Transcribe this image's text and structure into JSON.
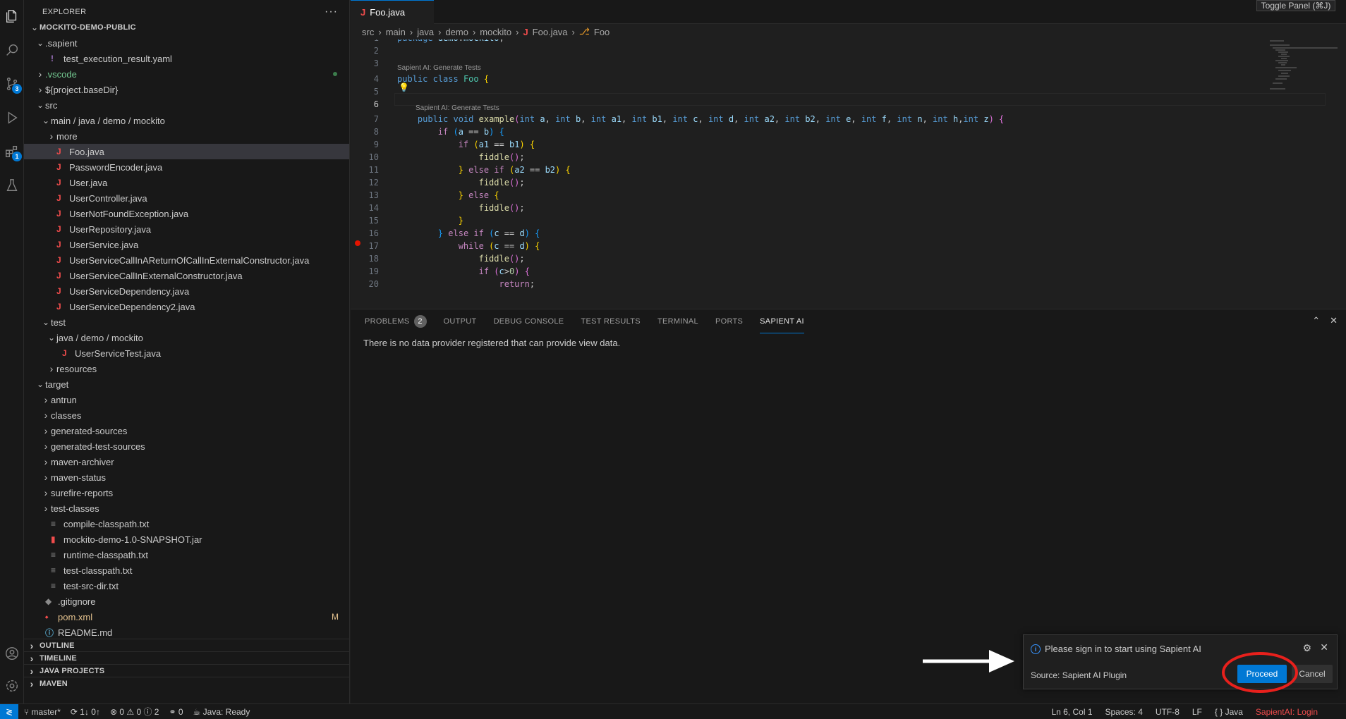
{
  "explorer": {
    "title": "EXPLORER",
    "more": "···",
    "items": [
      {
        "label": "MOCKITO-DEMO-PUBLIC",
        "twisty": "down",
        "indent": 0,
        "bold": true
      },
      {
        "label": ".sapient",
        "twisty": "down",
        "indent": 1
      },
      {
        "label": "test_execution_result.yaml",
        "icon": "!",
        "indent": 2
      },
      {
        "label": ".vscode",
        "twisty": "right",
        "indent": 1,
        "color": "#73c991",
        "dot": true
      },
      {
        "label": "${project.baseDir}",
        "twisty": "right",
        "indent": 1
      },
      {
        "label": "src",
        "twisty": "down",
        "indent": 1
      },
      {
        "label": "main / java / demo / mockito",
        "twisty": "down",
        "indent": 2
      },
      {
        "label": "more",
        "twisty": "right",
        "indent": 3
      },
      {
        "label": "Foo.java",
        "icon": "J",
        "indent": 3,
        "selected": true
      },
      {
        "label": "PasswordEncoder.java",
        "icon": "J",
        "indent": 3
      },
      {
        "label": "User.java",
        "icon": "J",
        "indent": 3
      },
      {
        "label": "UserController.java",
        "icon": "J",
        "indent": 3
      },
      {
        "label": "UserNotFoundException.java",
        "icon": "J",
        "indent": 3
      },
      {
        "label": "UserRepository.java",
        "icon": "J",
        "indent": 3
      },
      {
        "label": "UserService.java",
        "icon": "J",
        "indent": 3
      },
      {
        "label": "UserServiceCallInAReturnOfCallInExternalConstructor.java",
        "icon": "J",
        "indent": 3
      },
      {
        "label": "UserServiceCallInExternalConstructor.java",
        "icon": "J",
        "indent": 3
      },
      {
        "label": "UserServiceDependency.java",
        "icon": "J",
        "indent": 3
      },
      {
        "label": "UserServiceDependency2.java",
        "icon": "J",
        "indent": 3
      },
      {
        "label": "test",
        "twisty": "down",
        "indent": 2
      },
      {
        "label": "java / demo / mockito",
        "twisty": "down",
        "indent": 3
      },
      {
        "label": "UserServiceTest.java",
        "icon": "J",
        "indent": 4
      },
      {
        "label": "resources",
        "twisty": "right",
        "indent": 3
      },
      {
        "label": "target",
        "twisty": "down",
        "indent": 1
      },
      {
        "label": "antrun",
        "twisty": "right",
        "indent": 2
      },
      {
        "label": "classes",
        "twisty": "right",
        "indent": 2
      },
      {
        "label": "generated-sources",
        "twisty": "right",
        "indent": 2
      },
      {
        "label": "generated-test-sources",
        "twisty": "right",
        "indent": 2
      },
      {
        "label": "maven-archiver",
        "twisty": "right",
        "indent": 2
      },
      {
        "label": "maven-status",
        "twisty": "right",
        "indent": 2
      },
      {
        "label": "surefire-reports",
        "twisty": "right",
        "indent": 2
      },
      {
        "label": "test-classes",
        "twisty": "right",
        "indent": 2
      },
      {
        "label": "compile-classpath.txt",
        "icon": "≡",
        "indent": 2
      },
      {
        "label": "mockito-demo-1.0-SNAPSHOT.jar",
        "icon": "▮",
        "indent": 2
      },
      {
        "label": "runtime-classpath.txt",
        "icon": "≡",
        "indent": 2
      },
      {
        "label": "test-classpath.txt",
        "icon": "≡",
        "indent": 2
      },
      {
        "label": "test-src-dir.txt",
        "icon": "≡",
        "indent": 2
      },
      {
        "label": ".gitignore",
        "icon": "◆",
        "indent": 1
      },
      {
        "label": "pom.xml",
        "icon": "⬩",
        "indent": 1,
        "color": "#e2c08d",
        "mark": "M"
      },
      {
        "label": "README.md",
        "icon": "ⓘ",
        "indent": 1
      }
    ],
    "sections": [
      "OUTLINE",
      "TIMELINE",
      "JAVA PROJECTS",
      "MAVEN"
    ]
  },
  "activity": {
    "scm_badge": "3",
    "ext_badge": "1"
  },
  "editor": {
    "tab": "Foo.java",
    "breadcrumb": [
      "src",
      "main",
      "java",
      "demo",
      "mockito",
      "Foo.java",
      "Foo"
    ],
    "lens1": "Sapient AI: Generate Tests",
    "lens2": "Sapient AI: Generate Tests",
    "line_numbers": [
      "1",
      "2",
      "3",
      "4",
      "5",
      "6",
      "7",
      "8",
      "9",
      "10",
      "11",
      "12",
      "13",
      "14",
      "15",
      "16",
      "17",
      "18",
      "19",
      "20"
    ]
  },
  "tooltip": "Toggle Panel (⌘J)",
  "panel": {
    "tabs": [
      "PROBLEMS",
      "OUTPUT",
      "DEBUG CONSOLE",
      "TEST RESULTS",
      "TERMINAL",
      "PORTS",
      "SAPIENT AI"
    ],
    "problems_count": "2",
    "message": "There is no data provider registered that can provide view data."
  },
  "notification": {
    "message": "Please sign in to start using Sapient AI",
    "source": "Source: Sapient AI Plugin",
    "proceed": "Proceed",
    "cancel": "Cancel"
  },
  "status": {
    "branch": "master*",
    "sync": "1↓ 0↑",
    "problems": "⊗ 0 ⚠ 0 ⓘ 2",
    "ports": "⚭ 0",
    "java": "Java: Ready",
    "position": "Ln 6, Col 1",
    "spaces": "Spaces: 4",
    "encoding": "UTF-8",
    "eol": "LF",
    "language": "{ } Java",
    "sapient": "SapientAI: Login"
  }
}
